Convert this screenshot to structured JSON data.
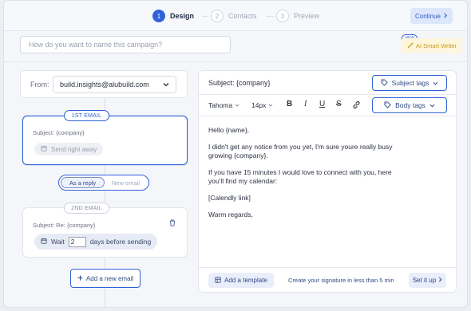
{
  "stepper": {
    "steps": [
      {
        "number": "1",
        "label": "Design",
        "active": true
      },
      {
        "number": "2",
        "label": "Contacts",
        "active": false
      },
      {
        "number": "3",
        "label": "Preview",
        "active": false
      }
    ],
    "continue_label": "Continue"
  },
  "campaign": {
    "name_placeholder": "How do you want to name this campaign?",
    "name_value": ""
  },
  "ai_writer": {
    "badge": "NEW",
    "label": "AI Smart Writer"
  },
  "sender": {
    "from_label": "From:",
    "from_value": "build.insights@alubuild.com"
  },
  "sequence": {
    "first_email": {
      "tag": "1ST EMAIL",
      "subject": "Subject: {company}",
      "send_label": "Send right away"
    },
    "mode_toggle": {
      "selected": "As a reply",
      "other": "New email"
    },
    "second_email": {
      "tag": "2ND EMAIL",
      "subject": "Subject: Re: {company}",
      "wait_label": "Wait",
      "wait_days": "2",
      "after_label": "days before sending"
    },
    "add_email_label": "Add a new email"
  },
  "editor": {
    "subject": "Subject: {company}",
    "subject_tags_label": "Subject tags",
    "body_tags_label": "Body tags",
    "font_family": "Tahoma",
    "font_size": "14px",
    "body_lines": [
      "Hello {name},",
      "I didn't get any notice from you yet, I'm sure youre really busy growing {company}.",
      "If you have 15 minutes I would love to connect with you, here you'll find my calendar:",
      "[Calendly link]",
      "Warm regards,"
    ],
    "footer": {
      "add_template_label": "Add a template",
      "signature_prompt": "Create your signature in less than 5 min",
      "setup_label": "Set it up"
    }
  },
  "colors": {
    "accent": "#2f62d8",
    "accent_light": "#dde7fb",
    "ai_yellow": "#fdf6dc"
  },
  "icons": {
    "calendar": "calendar-icon",
    "trash": "trash-icon",
    "tag": "tag-icon",
    "chevron_down": "chevron-down-icon",
    "chevron_right": "chevron-right-icon",
    "plus": "plus-icon",
    "wand": "magic-wand-icon"
  }
}
